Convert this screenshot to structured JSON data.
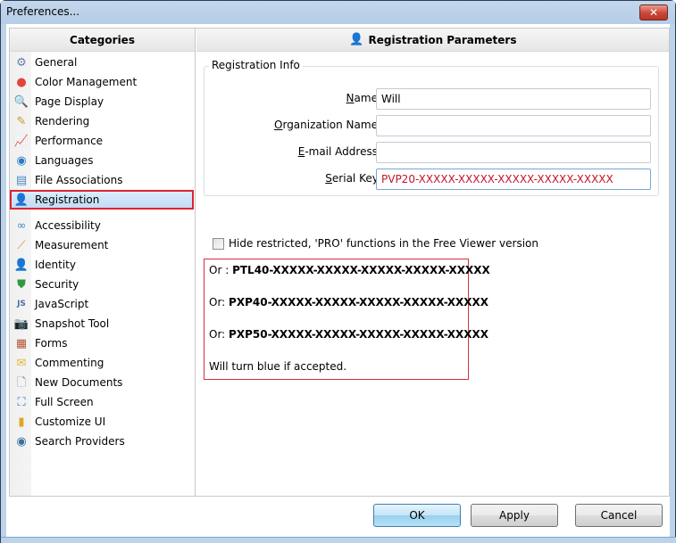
{
  "window": {
    "title": "Preferences...",
    "close_icon": "close-icon"
  },
  "categories": {
    "header": "Categories",
    "selected_index": 7,
    "items": [
      {
        "label": "General",
        "icon": "gears-icon",
        "glyph": "⚙",
        "color": "#6a7fa8"
      },
      {
        "label": "Color Management",
        "icon": "color-circles-icon",
        "glyph": "●",
        "color": "#e0463a"
      },
      {
        "label": "Page Display",
        "icon": "magnifier-icon",
        "glyph": "🔍",
        "color": "#4a79b8"
      },
      {
        "label": "Rendering",
        "icon": "brush-icon",
        "glyph": "✎",
        "color": "#c79a24"
      },
      {
        "label": "Performance",
        "icon": "chart-icon",
        "glyph": "📈",
        "color": "#3d9a3d"
      },
      {
        "label": "Languages",
        "icon": "globe-icon",
        "glyph": "◉",
        "color": "#2d7bc2"
      },
      {
        "label": "File Associations",
        "icon": "file-associations-icon",
        "glyph": "▤",
        "color": "#4b87c5"
      },
      {
        "label": "Registration",
        "icon": "user-key-icon",
        "glyph": "👤",
        "color": "#d9792e"
      },
      {
        "label": "Accessibility",
        "icon": "accessibility-icon",
        "glyph": "∞",
        "color": "#4a86c7"
      },
      {
        "label": "Measurement",
        "icon": "ruler-icon",
        "glyph": "⟋",
        "color": "#d28a2a"
      },
      {
        "label": "Identity",
        "icon": "identity-icon",
        "glyph": "👤",
        "color": "#d9792e"
      },
      {
        "label": "Security",
        "icon": "shield-icon",
        "glyph": "⛊",
        "color": "#2f9a3a"
      },
      {
        "label": "JavaScript",
        "icon": "javascript-icon",
        "glyph": "JS",
        "color": "#4d6fa5"
      },
      {
        "label": "Snapshot Tool",
        "icon": "camera-icon",
        "glyph": "📷",
        "color": "#6c7a8c"
      },
      {
        "label": "Forms",
        "icon": "forms-icon",
        "glyph": "▦",
        "color": "#b4563a"
      },
      {
        "label": "Commenting",
        "icon": "comment-icon",
        "glyph": "✉",
        "color": "#e2b63a"
      },
      {
        "label": "New Documents",
        "icon": "new-document-icon",
        "glyph": "🗋",
        "color": "#7b8a99"
      },
      {
        "label": "Full Screen",
        "icon": "full-screen-icon",
        "glyph": "⛶",
        "color": "#2b79c6"
      },
      {
        "label": "Customize UI",
        "icon": "customize-ui-icon",
        "glyph": "▮",
        "color": "#e2a422"
      },
      {
        "label": "Search Providers",
        "icon": "search-providers-icon",
        "glyph": "◉",
        "color": "#3a6f9c"
      }
    ]
  },
  "main": {
    "header": "Registration Parameters",
    "header_icon": "user-key-icon",
    "group_title": "Registration Info",
    "fields": [
      {
        "label_access": "N",
        "label_rest": "ame:",
        "value": "Will",
        "name": "name-field"
      },
      {
        "label_access": "O",
        "label_rest": "rganization Name:",
        "value": "",
        "name": "organization-name-field"
      },
      {
        "label_access": "E",
        "label_rest": "-mail Address:",
        "value": "",
        "name": "email-field"
      },
      {
        "label_access": "S",
        "label_rest": "erial Key:",
        "value": "PVP20-XXXXX-XXXXX-XXXXX-XXXXX-XXXXX",
        "name": "serial-key-field"
      }
    ],
    "checkbox": {
      "label": "Hide restricted, 'PRO' functions in the Free Viewer version",
      "checked": false
    },
    "note": {
      "lines": [
        {
          "prefix": "Or : ",
          "key": "PTL40-XXXXX-XXXXX-XXXXX-XXXXX-XXXXX"
        },
        {
          "prefix": "Or: ",
          "key": "PXP40-XXXXX-XXXXX-XXXXX-XXXXX-XXXXX"
        },
        {
          "prefix": "Or: ",
          "key": "PXP50-XXXXX-XXXXX-XXXXX-XXXXX-XXXXX"
        }
      ],
      "footer": "Will turn blue if accepted."
    }
  },
  "buttons": {
    "ok": "OK",
    "apply": "Apply",
    "cancel": "Cancel"
  },
  "colors": {
    "selection_highlight": "#e0232d",
    "serial_text": "#c0172b",
    "note_border": "#d4313a"
  }
}
